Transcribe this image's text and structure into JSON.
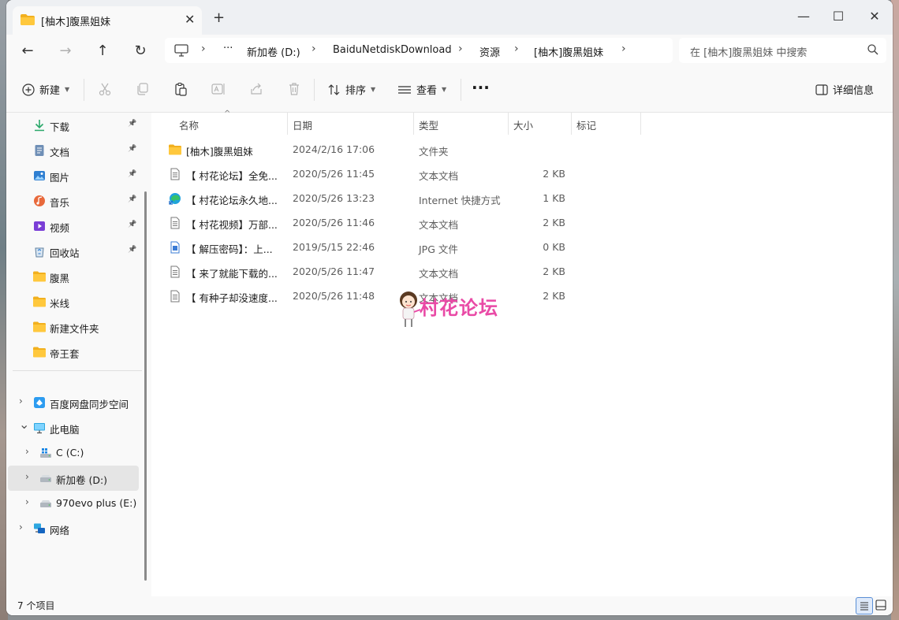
{
  "tab": {
    "title": "[柚木]腹黑姐妹",
    "close": "✕",
    "new_tab": "+"
  },
  "window_controls": {
    "minimize": "—",
    "maximize": "☐",
    "close": "✕"
  },
  "nav": {
    "back": "←",
    "forward": "→",
    "up": "↑",
    "refresh": "↻"
  },
  "address": {
    "more": "···",
    "crumbs": [
      "新加卷 (D:)",
      "BaiduNetdiskDownload",
      "资源",
      "[柚木]腹黑姐妹"
    ]
  },
  "search": {
    "placeholder": "在 [柚木]腹黑姐妹 中搜索"
  },
  "toolbar": {
    "new_label": "新建",
    "sort_label": "排序",
    "view_label": "查看",
    "more_label": "···",
    "details_label": "详细信息"
  },
  "sidebar": {
    "quick": [
      {
        "label": "下载",
        "icon": "download-icon",
        "pinned": true
      },
      {
        "label": "文档",
        "icon": "document-icon",
        "pinned": true
      },
      {
        "label": "图片",
        "icon": "picture-icon",
        "pinned": true
      },
      {
        "label": "音乐",
        "icon": "music-icon",
        "pinned": true
      },
      {
        "label": "视频",
        "icon": "video-icon",
        "pinned": true
      },
      {
        "label": "回收站",
        "icon": "recycle-bin-icon",
        "pinned": true
      },
      {
        "label": "腹黑",
        "icon": "folder-icon",
        "pinned": false
      },
      {
        "label": "米线",
        "icon": "folder-icon",
        "pinned": false
      },
      {
        "label": "新建文件夹",
        "icon": "folder-icon",
        "pinned": false
      },
      {
        "label": "帝王套",
        "icon": "folder-icon",
        "pinned": false
      }
    ],
    "tree": [
      {
        "label": "百度网盘同步空间",
        "icon": "baidu-sync-icon",
        "expanded": false,
        "indent": 0
      },
      {
        "label": "此电脑",
        "icon": "computer-icon",
        "expanded": true,
        "indent": 0
      },
      {
        "label": "C (C:)",
        "icon": "windows-drive-icon",
        "expanded": false,
        "indent": 1
      },
      {
        "label": "新加卷 (D:)",
        "icon": "drive-icon",
        "expanded": false,
        "indent": 1,
        "selected": true
      },
      {
        "label": "970evo plus (E:)",
        "icon": "drive-icon",
        "expanded": false,
        "indent": 1
      },
      {
        "label": "网络",
        "icon": "network-icon",
        "expanded": false,
        "indent": 0
      }
    ]
  },
  "columns": {
    "name": "名称",
    "date": "日期",
    "type": "类型",
    "size": "大小",
    "tag": "标记"
  },
  "files": [
    {
      "name": "[柚木]腹黑姐妹",
      "date": "2024/2/16 17:06",
      "type": "文件夹",
      "size": "",
      "icon": "folder-icon"
    },
    {
      "name": "【 村花论坛】全免...",
      "date": "2020/5/26 11:45",
      "type": "文本文档",
      "size": "2 KB",
      "icon": "text-file-icon"
    },
    {
      "name": "【 村花论坛永久地...",
      "date": "2020/5/26 13:23",
      "type": "Internet 快捷方式",
      "size": "1 KB",
      "icon": "edge-shortcut-icon"
    },
    {
      "name": "【 村花视频】万部...",
      "date": "2020/5/26 11:46",
      "type": "文本文档",
      "size": "2 KB",
      "icon": "text-file-icon"
    },
    {
      "name": "【 解压密码】：上...",
      "date": "2019/5/15 22:46",
      "type": "JPG 文件",
      "size": "0 KB",
      "icon": "image-file-icon"
    },
    {
      "name": "【 来了就能下载的...",
      "date": "2020/5/26 11:47",
      "type": "文本文档",
      "size": "2 KB",
      "icon": "text-file-icon"
    },
    {
      "name": "【 有种子却没速度...",
      "date": "2020/5/26 11:48",
      "type": "文本文档",
      "size": "2 KB",
      "icon": "text-file-icon"
    }
  ],
  "watermark": {
    "text": "村花论坛"
  },
  "status": {
    "count": "7 个项目"
  }
}
